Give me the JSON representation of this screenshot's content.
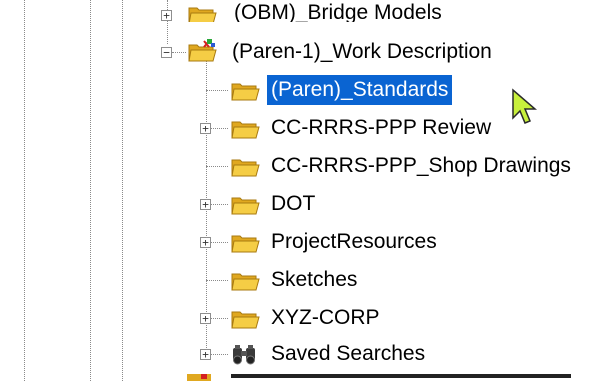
{
  "tree": {
    "items": [
      {
        "label": "(OBM)_Bridge Models",
        "icon": "folder-project-icon"
      },
      {
        "label": "(Paren-1)_Work Description",
        "icon": "folder-project-icon"
      },
      {
        "label": "(Paren)_Standards",
        "icon": "folder-icon",
        "selected": true
      },
      {
        "label": "CC-RRRS-PPP Review",
        "icon": "folder-icon"
      },
      {
        "label": "CC-RRRS-PPP_Shop Drawings",
        "icon": "folder-icon"
      },
      {
        "label": "DOT",
        "icon": "folder-icon"
      },
      {
        "label": "ProjectResources",
        "icon": "folder-icon"
      },
      {
        "label": "Sketches",
        "icon": "folder-icon"
      },
      {
        "label": "XYZ-CORP",
        "icon": "folder-icon"
      },
      {
        "label": "Saved Searches",
        "icon": "binoculars-icon"
      }
    ]
  },
  "colors": {
    "selection": "#0a64d2",
    "folder": "#f2c230",
    "cursor": "#c8f03c"
  }
}
